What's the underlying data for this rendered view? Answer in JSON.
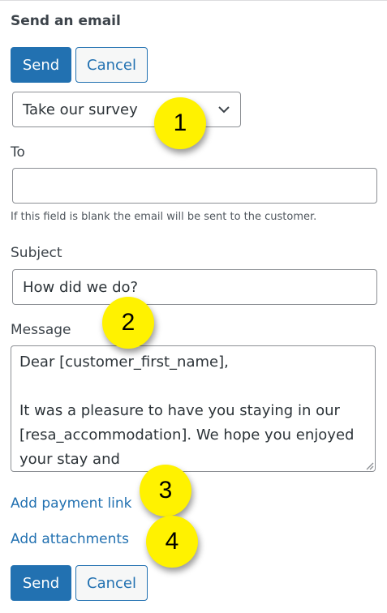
{
  "form": {
    "title": "Send an email",
    "send_label": "Send",
    "cancel_label": "Cancel",
    "template_select": {
      "value": "Take our survey"
    },
    "to": {
      "label": "To",
      "value": "",
      "help": "If this field is blank the email will be sent to the customer."
    },
    "subject": {
      "label": "Subject",
      "value": "How did we do?"
    },
    "message": {
      "label": "Message",
      "value": "Dear [customer_first_name],\n\nIt was a pleasure to have you staying in our [resa_accommodation]. We hope you enjoyed your stay and"
    },
    "add_payment_link": "Add payment link",
    "add_attachments": "Add attachments",
    "bottom_send_label": "Send",
    "bottom_cancel_label": "Cancel"
  },
  "callouts": [
    "1",
    "2",
    "3",
    "4"
  ],
  "icons": {
    "select_arrow": "chevron-down-icon",
    "resize_handle": "resize-grip-icon"
  },
  "colors": {
    "primary": "#2271b1",
    "callout": "#fff200",
    "text": "#3c434a",
    "border": "#8c8f94"
  }
}
